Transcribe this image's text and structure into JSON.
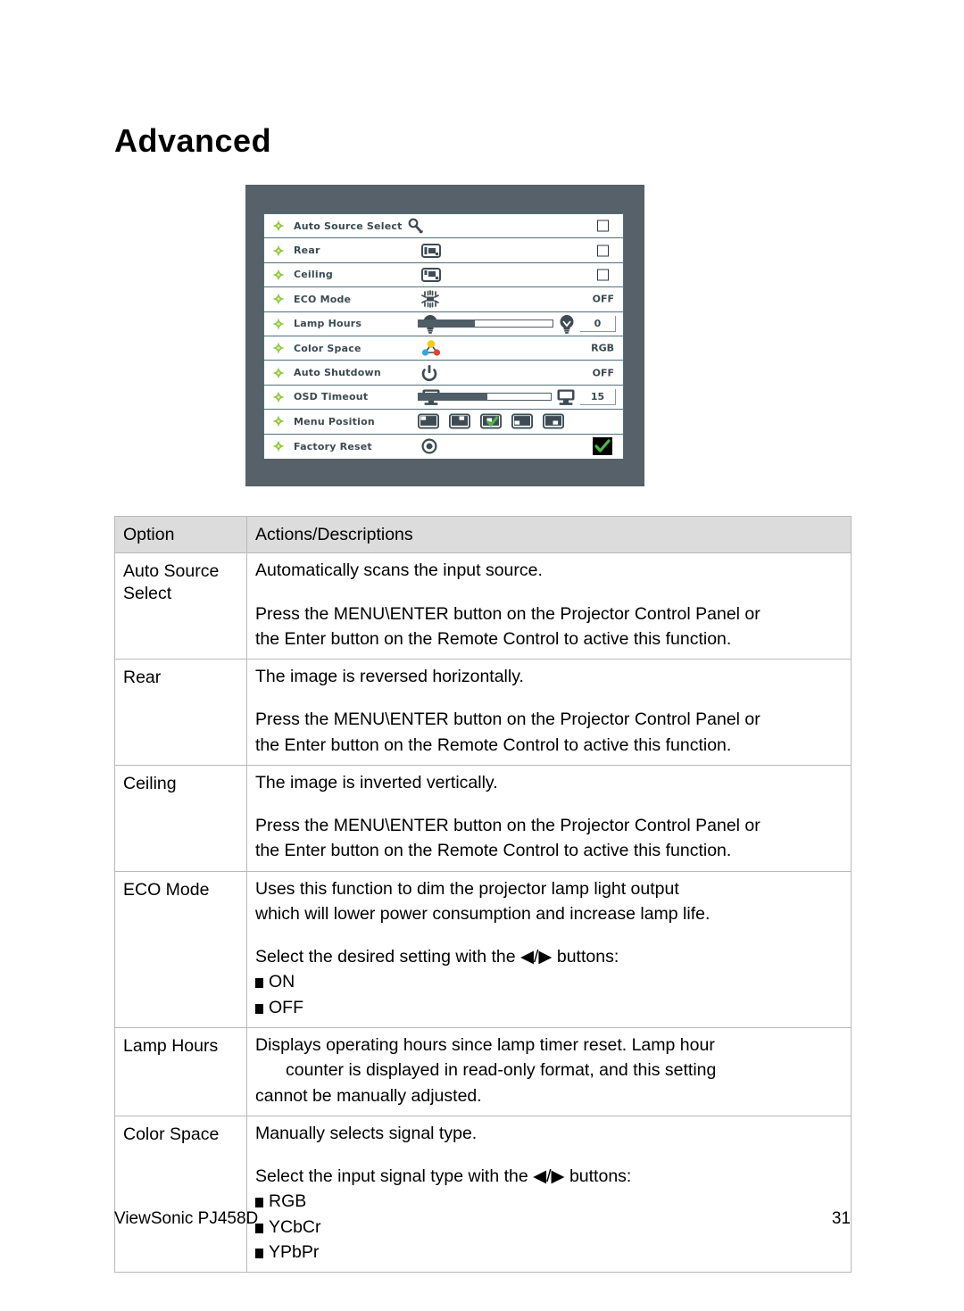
{
  "document": {
    "title": "Advanced"
  },
  "osd": {
    "rows": [
      {
        "label": "Auto Source Select",
        "icon": "wrench-icon",
        "icon_inline": true,
        "control": "checkbox",
        "value": ""
      },
      {
        "label": "Rear",
        "icon": "rear-projection-icon",
        "icon_inline": false,
        "control": "checkbox",
        "value": ""
      },
      {
        "label": "Ceiling",
        "icon": "ceiling-projection-icon",
        "icon_inline": false,
        "control": "checkbox",
        "value": ""
      },
      {
        "label": "ECO Mode",
        "icon": "eco-brightness-icon",
        "icon_inline": false,
        "control": "text",
        "value": "OFF"
      },
      {
        "label": "Lamp Hours",
        "icon": "lamp-icon",
        "icon_inline": false,
        "control": "slider",
        "value": "0",
        "slider_percent": 42
      },
      {
        "label": "Color Space",
        "icon": "color-space-icon",
        "icon_inline": false,
        "control": "text",
        "value": "RGB"
      },
      {
        "label": "Auto Shutdown",
        "icon": "power-icon",
        "icon_inline": false,
        "control": "text",
        "value": "OFF"
      },
      {
        "label": "OSD Timeout",
        "icon": "monitor-icon",
        "icon_inline": false,
        "control": "slider",
        "value": "15",
        "slider_percent": 52
      },
      {
        "label": "Menu Position",
        "icon": "menu-position-icon",
        "icon_inline": false,
        "control": "menu-positions",
        "value": "",
        "positions": [
          "menu-position-top-left-icon",
          "menu-position-top-right-icon",
          "menu-position-center-icon",
          "menu-position-bottom-left-icon",
          "menu-position-bottom-right-icon"
        ],
        "selected_position_index": 2
      },
      {
        "label": "Factory Reset",
        "icon": "reset-icon",
        "icon_inline": false,
        "control": "tick",
        "value": ""
      }
    ],
    "colors": {
      "panel_background": "#566169",
      "row_background": "#ffffff",
      "row_border": "#50707a",
      "text": "#3b4a52",
      "bullet_green": "#8ec63f",
      "accent_green": "#4cb648",
      "slider_fill": "#4e5d66"
    }
  },
  "table": {
    "headers": [
      "Option",
      "Actions/Descriptions"
    ],
    "rows": [
      {
        "option": "Auto Source\nSelect",
        "paragraphs": [
          {
            "type": "text",
            "text": "Automatically scans the input source."
          },
          {
            "type": "gap"
          },
          {
            "type": "text",
            "text": "Press the MENU\\ENTER button on the Projector Control Panel or"
          },
          {
            "type": "text",
            "text": "the Enter button on the Remote Control to active this function."
          }
        ]
      },
      {
        "option": "Rear",
        "paragraphs": [
          {
            "type": "text",
            "text": "The image is reversed horizontally."
          },
          {
            "type": "gap"
          },
          {
            "type": "text",
            "text": "Press the MENU\\ENTER button on the Projector Control Panel or"
          },
          {
            "type": "text",
            "text": "the Enter button on the Remote Control to active this function."
          }
        ]
      },
      {
        "option": "Ceiling",
        "paragraphs": [
          {
            "type": "text",
            "text": "The image is inverted vertically."
          },
          {
            "type": "gap"
          },
          {
            "type": "text",
            "text": "Press the MENU\\ENTER button on the Projector Control Panel or"
          },
          {
            "type": "text",
            "text": "the Enter button on the Remote Control to active this function."
          }
        ]
      },
      {
        "option": "ECO Mode",
        "paragraphs": [
          {
            "type": "text",
            "text": "Uses this function to dim the projector lamp light output"
          },
          {
            "type": "text",
            "text": "which will lower power consumption and increase lamp life."
          },
          {
            "type": "gap"
          },
          {
            "type": "arrows",
            "before": "Select the desired setting with the ",
            "arrows": "◀/▶",
            "after": " buttons:"
          },
          {
            "type": "bullet",
            "text": "ON"
          },
          {
            "type": "bullet",
            "text": "OFF"
          }
        ]
      },
      {
        "option": "Lamp Hours",
        "paragraphs": [
          {
            "type": "text",
            "text": "Displays operating hours since lamp timer reset. Lamp hour"
          },
          {
            "type": "indent",
            "text": "counter is displayed in read-only format, and this setting"
          },
          {
            "type": "text",
            "text": "cannot be manually adjusted."
          }
        ]
      },
      {
        "option": "Color Space",
        "paragraphs": [
          {
            "type": "text",
            "text": "Manually selects signal type."
          },
          {
            "type": "gap"
          },
          {
            "type": "arrows",
            "before": "Select the input signal type with the ",
            "arrows": "◀/▶",
            "after": " buttons:"
          },
          {
            "type": "bullet",
            "text": "RGB"
          },
          {
            "type": "bullet",
            "text": "YCbCr"
          },
          {
            "type": "bullet",
            "text": "YPbPr"
          }
        ]
      }
    ]
  },
  "footer": {
    "left": "ViewSonic PJ458D",
    "page_number": "31"
  }
}
